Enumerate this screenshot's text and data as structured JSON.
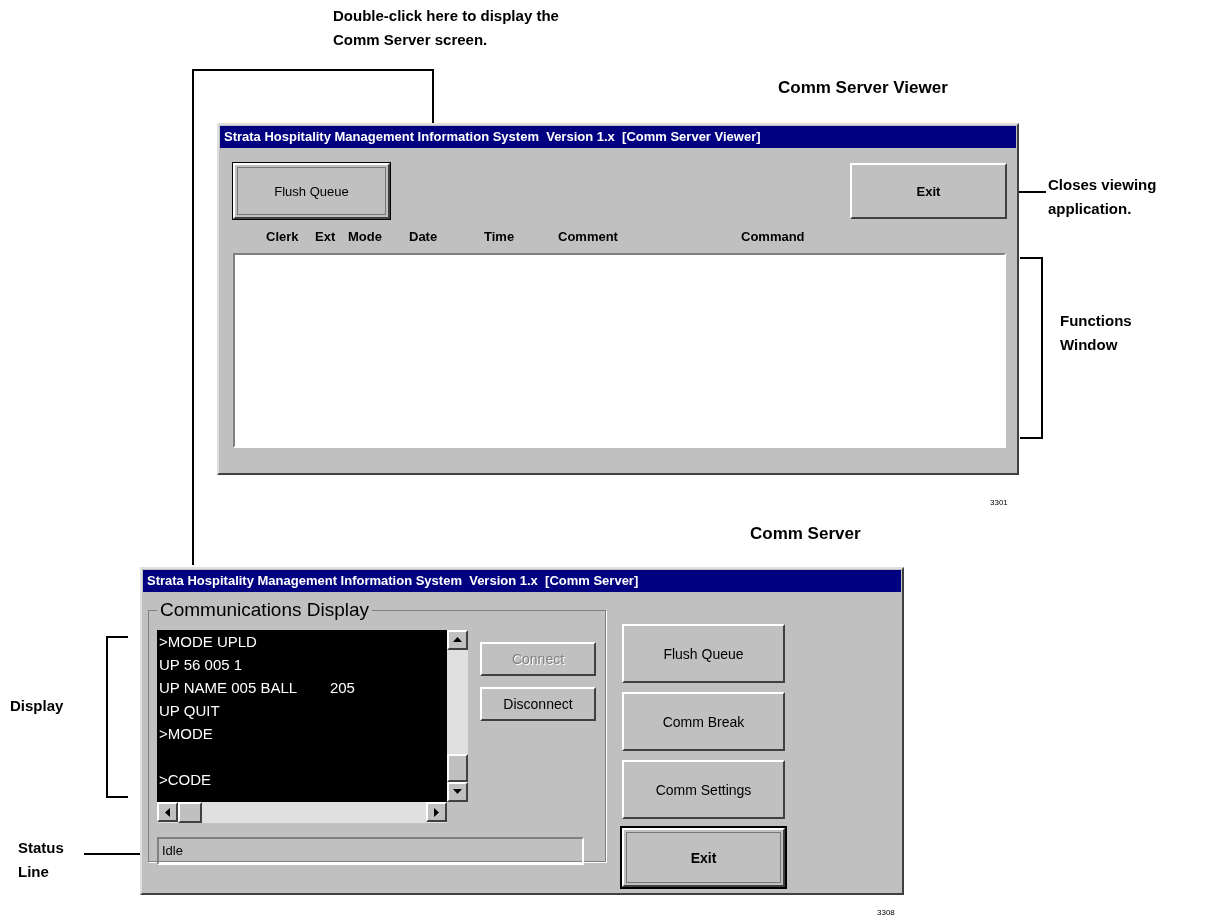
{
  "caption_top": [
    "Double-click here to display the",
    "Comm Server screen."
  ],
  "viewer": {
    "heading": "Comm Server Viewer",
    "title": "Strata Hospitality Management Information System  Version 1.x  [Comm Server Viewer]",
    "buttons": [
      {
        "label": "Flush Queue",
        "focused": true
      },
      {
        "label": "Exit",
        "focused": false
      }
    ],
    "columns": [
      "Clerk",
      "Ext",
      "Mode",
      "Date",
      "Time",
      "Comment",
      "Command"
    ],
    "figure_number": "3301"
  },
  "callouts": {
    "exit": [
      "Closes viewing",
      "application."
    ],
    "functions": [
      "Functions",
      "Window"
    ],
    "display": "Display",
    "status": [
      "Status",
      "Line"
    ]
  },
  "server": {
    "heading": "Comm Server",
    "title": "Strata Hospitality Management Information System  Version 1.x  [Comm Server]",
    "group_label": "Communications Display",
    "display_blocks": [
      [
        ">MODE UPLD",
        "UP 56 005 1",
        "UP NAME 005 BALL        205",
        "UP QUIT",
        ">MODE"
      ],
      [
        ">CODE"
      ]
    ],
    "link_buttons": [
      {
        "label": "Connect",
        "disabled": true
      },
      {
        "label": "Disconnect",
        "disabled": false
      }
    ],
    "status": "Idle",
    "buttons": [
      {
        "label": "Flush Queue",
        "focused": false
      },
      {
        "label": "Comm Break",
        "focused": false
      },
      {
        "label": "Comm Settings",
        "focused": false
      },
      {
        "label": "Exit",
        "focused": true
      }
    ],
    "figure_number": "3308"
  }
}
